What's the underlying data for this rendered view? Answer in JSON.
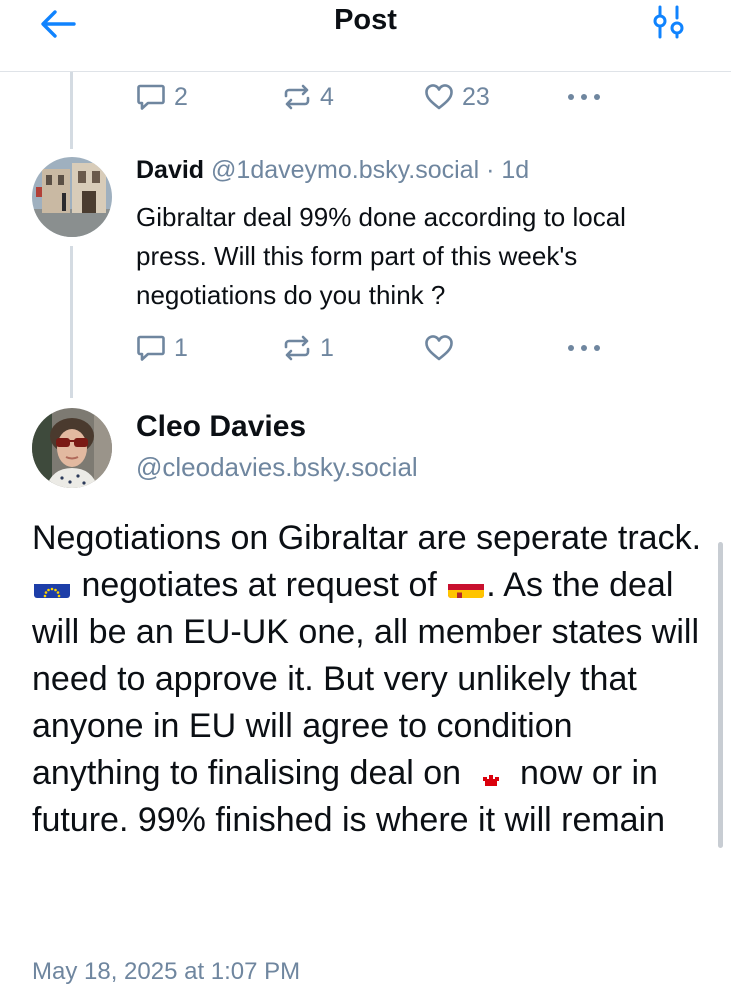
{
  "header": {
    "title": "Post"
  },
  "parent_actions": {
    "replies": "2",
    "reposts": "4",
    "likes": "23"
  },
  "reply": {
    "name": "David",
    "handle": "@1daveymo.bsky.social",
    "separator": "·",
    "time": "1d",
    "text": "Gibraltar deal 99% done according to local press. Will this form part of this week's negotiations do you think ?",
    "actions": {
      "replies": "1",
      "reposts": "1"
    }
  },
  "main_post": {
    "name": "Cleo Davies",
    "handle": "@cleodavies.bsky.social",
    "text_1": "Negotiations on Gibraltar are seperate track.",
    "text_2": "negotiates at request of",
    "text_3": ". As the deal will be an EU-UK one, all member states will need to approve it. But very unlikely that anyone in EU will agree to condition anything to finalising deal on",
    "text_4": "now or in future. 99% finished is where it will remain",
    "timestamp": "May 18, 2025 at 1:07 PM"
  },
  "flags": [
    "eu-flag",
    "spain-flag",
    "gibraltar-flag"
  ],
  "icons": [
    "back-arrow-icon",
    "filter-icon",
    "comment-icon",
    "repost-icon",
    "heart-icon",
    "more-icon"
  ],
  "colors": {
    "text": "#0b0f14",
    "muted": "#6f869f",
    "accent": "#1083fe",
    "divider": "#dfe3e8",
    "thread_line": "#d4dbe2"
  }
}
